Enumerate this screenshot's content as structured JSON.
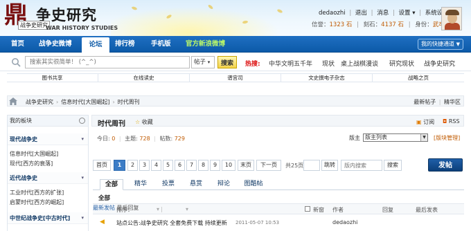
{
  "header": {
    "logo_mark": "鼎",
    "logo_title": "争史研究",
    "logo_badge": "战争史研究",
    "logo_en": "WAR HISTORY STUDIES",
    "user": {
      "username": "dedaozhi",
      "links": [
        "退出",
        "消息",
        "设置",
        "系统设置"
      ],
      "stats": [
        {
          "label": "信誉：",
          "value": "1323 石"
        },
        {
          "label": "刻石：",
          "value": "4137 石"
        },
        {
          "label": "身份：",
          "value": "武卒"
        }
      ]
    }
  },
  "nav": {
    "items": [
      "首页",
      "战争史微博",
      "论坛",
      "排行榜",
      "手机版",
      "官方新浪微博"
    ],
    "active": "论坛",
    "quick": "我的快捷通道"
  },
  "search": {
    "placeholder": "搜索其实很简单！ (^_^)",
    "type": "帖子",
    "button": "搜索",
    "hot_label": "热搜:",
    "hot_links": [
      "中华文明五千年",
      "现状",
      "桌上战棋漫谈",
      "研究现状",
      "战争史研究"
    ]
  },
  "quick_links": [
    "图书共享",
    "在线读史",
    "谱宫司",
    "文史撰电子杂志",
    "战略之页"
  ],
  "breadcrumb": {
    "items": [
      "战争史研究",
      "信息时代[大国崛起]",
      "时代周刊"
    ],
    "right": [
      "最新帖子",
      "精华区"
    ]
  },
  "sidebar": {
    "header": "我的板块",
    "groups": [
      {
        "title": "现代战争史",
        "items": [
          "信息时代[大国崛起]",
          "现代[西方的衰落]"
        ]
      },
      {
        "title": "近代战争史",
        "items": [
          "工业时代[西方的扩张]",
          "启蒙时代[西方的崛起]"
        ]
      },
      {
        "title": "中世纪战争史[中古时代]",
        "items": []
      }
    ]
  },
  "forum": {
    "title": "时代周刊",
    "favorite": "收藏",
    "subscribe": "订阅",
    "rss": "RSS",
    "stats": {
      "today_label": "今日:",
      "today": "0",
      "topics_label": "主题:",
      "topics": "728",
      "posts_label": "帖数:",
      "posts": "729"
    },
    "moderator_label": "版主",
    "moderator_select": "版主列表",
    "manage": "[版块管理]",
    "pager": {
      "first": "首页",
      "pages": [
        "1",
        "2",
        "3",
        "4",
        "5",
        "6",
        "7",
        "8",
        "9",
        "10"
      ],
      "current": "1",
      "last": "末页",
      "next": "下一页",
      "total": "共25页",
      "goto": "跳转",
      "search_placeholder": "版内搜索",
      "search_button": "搜索"
    },
    "post_button": "发帖",
    "tabs": [
      "全部",
      "精华",
      "投票",
      "悬赏",
      "辩论",
      "图酷帖"
    ],
    "active_tab": "全部",
    "sub_filter": "全部",
    "list_header": {
      "sort": "排序：",
      "sort_new": "最新发帖",
      "sort_reply": "最后回复",
      "new_window": "新窗",
      "author": "作者",
      "reply": "回复",
      "last_post": "最后发表"
    },
    "rows": [
      {
        "title": "站点公告:战争史研究 全套免费下载 持续更新",
        "time": "2011-05-07 10:53",
        "author": "dedaozhi"
      }
    ]
  }
}
